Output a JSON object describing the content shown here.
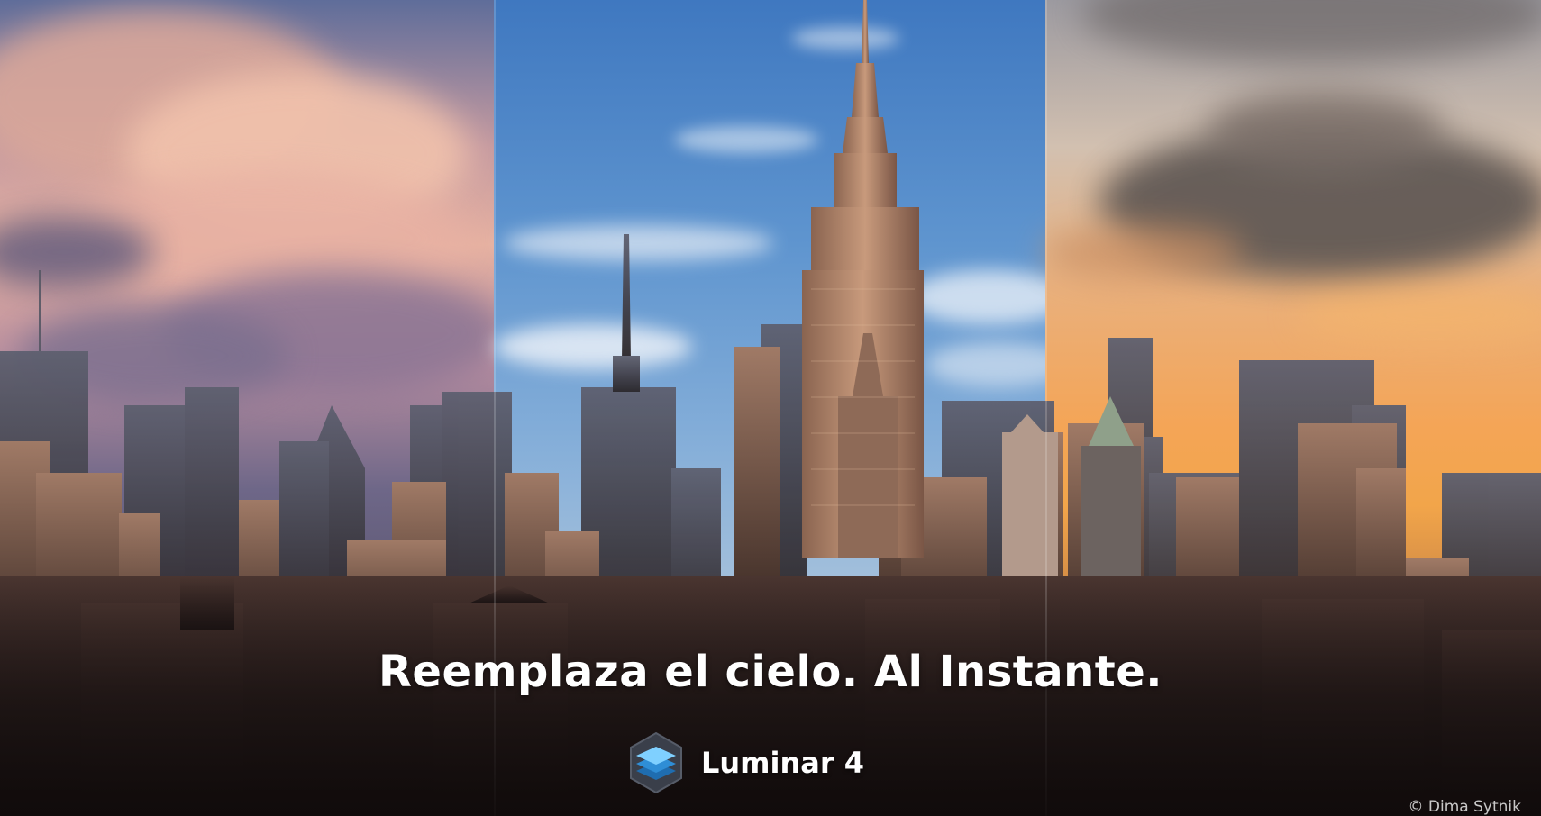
{
  "headline": "Reemplaza el cielo. Al Instante.",
  "brand": {
    "name": "Luminar 4",
    "logo_icon": "luminar-layers-icon"
  },
  "credit": "© Dima Sytnik",
  "panels": [
    {
      "name": "sunset-pink-clouds-sky"
    },
    {
      "name": "clear-blue-sky"
    },
    {
      "name": "golden-hour-orange-sky"
    }
  ],
  "colors": {
    "headline_text": "#ffffff",
    "logo_blue": "#3aa3e8"
  }
}
